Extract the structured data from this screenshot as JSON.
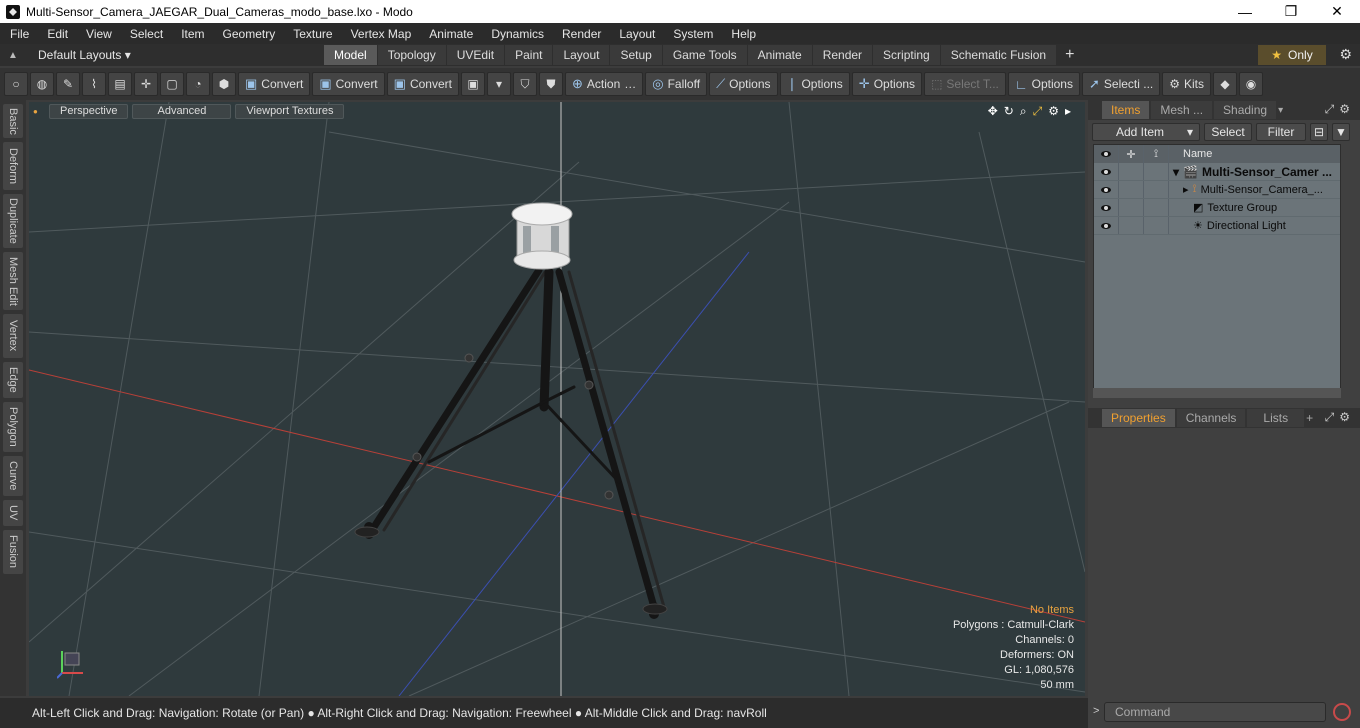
{
  "window": {
    "title": "Multi-Sensor_Camera_JAEGAR_Dual_Cameras_modo_base.lxo - Modo",
    "minimize": "—",
    "maximize": "❐",
    "close": "✕"
  },
  "menu": [
    "File",
    "Edit",
    "View",
    "Select",
    "Item",
    "Geometry",
    "Texture",
    "Vertex Map",
    "Animate",
    "Dynamics",
    "Render",
    "Layout",
    "System",
    "Help"
  ],
  "layoutbar": {
    "default_layouts": "Default Layouts ▾",
    "tabs": [
      "Model",
      "Topology",
      "UVEdit",
      "Paint",
      "Layout",
      "Setup",
      "Game Tools",
      "Animate",
      "Render",
      "Scripting",
      "Schematic Fusion"
    ],
    "active_tab": "Model",
    "plus": "+",
    "only_label": "Only",
    "only_star": "★"
  },
  "toolbar": {
    "convert1": "Convert",
    "convert2": "Convert",
    "convert3": "Convert",
    "action": "Action",
    "falloff": "Falloff",
    "options1": "Options",
    "options2": "Options",
    "options3": "Options",
    "select_t": "Select T...",
    "options4": "Options",
    "selecti": "Selecti ...",
    "kits": "Kits"
  },
  "sidetabs": [
    "Basic",
    "Deform",
    "Duplicate",
    "Mesh Edit",
    "Vertex",
    "Edge",
    "Polygon",
    "Curve",
    "UV",
    "Fusion"
  ],
  "viewport": {
    "perspective": "Perspective",
    "advanced": "Advanced",
    "viewport_textures": "Viewport Textures",
    "stats": {
      "no_items": "No Items",
      "polygons": "Polygons : Catmull-Clark",
      "channels": "Channels: 0",
      "deformers": "Deformers: ON",
      "gl": "GL: 1,080,576",
      "focal": "50 mm"
    }
  },
  "statusbar": {
    "hint": "Alt-Left Click and Drag: Navigation: Rotate (or Pan) ● Alt-Right Click and Drag: Navigation: Freewheel ● Alt-Middle Click and Drag: navRoll"
  },
  "items_panel": {
    "tabs": [
      "Items",
      "Mesh ...",
      "Shading"
    ],
    "active_tab": "Items",
    "add_item": "Add Item",
    "select": "Select",
    "filter": "Filter",
    "column_name": "Name",
    "rows": [
      {
        "label": "Multi-Sensor_Camer ...",
        "bold": true
      },
      {
        "label": "Multi-Sensor_Camera_...",
        "bold": false
      },
      {
        "label": "Texture Group",
        "bold": false
      },
      {
        "label": "Directional Light",
        "bold": false
      }
    ]
  },
  "properties_panel": {
    "tabs": [
      "Properties",
      "Channels",
      "Lists"
    ],
    "active_tab": "Properties",
    "plus": "+"
  },
  "command": {
    "placeholder": "Command",
    "arrow": ">"
  }
}
